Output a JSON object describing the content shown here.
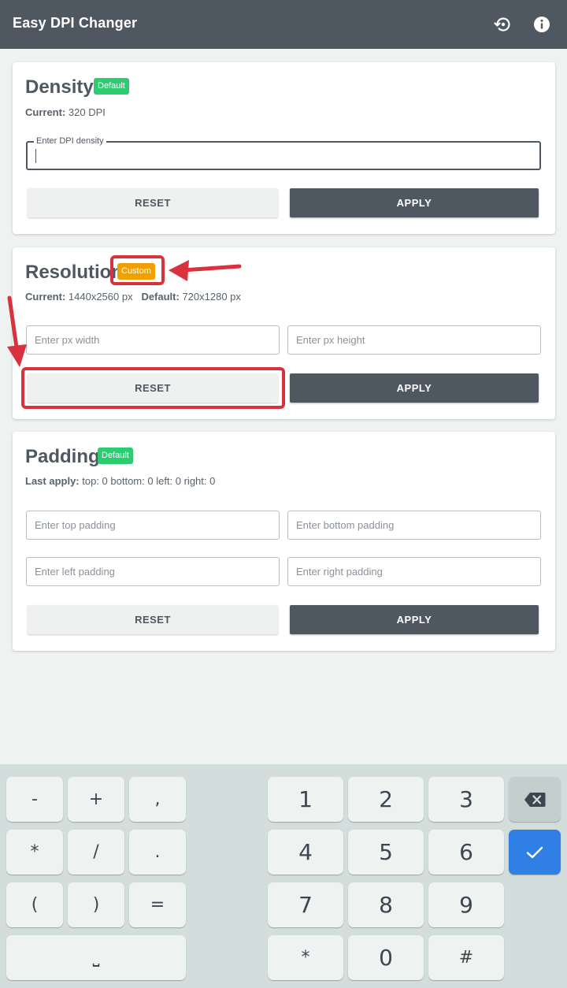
{
  "app": {
    "title": "Easy DPI Changer",
    "icons": [
      "restore-icon",
      "info-icon"
    ]
  },
  "density": {
    "title": "Density",
    "badge": "Default",
    "current_label": "Current:",
    "current_value": "320 DPI",
    "input_label": "Enter DPI density",
    "input_value": "",
    "reset_label": "RESET",
    "apply_label": "APPLY"
  },
  "resolution": {
    "title": "Resolution",
    "badge": "Custom",
    "current_label": "Current:",
    "current_value": "1440x2560 px",
    "default_label": "Default:",
    "default_value": "720x1280 px",
    "width_placeholder": "Enter px width",
    "height_placeholder": "Enter px height",
    "reset_label": "RESET",
    "apply_label": "APPLY"
  },
  "padding": {
    "title": "Padding",
    "badge": "Default",
    "last_label": "Last apply:",
    "last_value": "top: 0 bottom: 0 left: 0 right: 0",
    "top_placeholder": "Enter top padding",
    "bottom_placeholder": "Enter bottom padding",
    "left_placeholder": "Enter left padding",
    "right_placeholder": "Enter right padding",
    "reset_label": "RESET",
    "apply_label": "APPLY"
  },
  "keyboard": {
    "symbol_keys": [
      "-",
      "+",
      ",",
      "*",
      "/",
      ".",
      "(",
      ")",
      "=",
      "⎵"
    ],
    "number_keys": [
      "1",
      "2",
      "3",
      "4",
      "5",
      "6",
      "7",
      "8",
      "9",
      "*",
      "0",
      "#"
    ],
    "icons": [
      "backspace-icon",
      "checkmark-icon"
    ]
  },
  "colors": {
    "appbar": "#4f5761",
    "badge_default": "#2ecc71",
    "badge_custom": "#f0a000",
    "annotation": "#d9323f",
    "keyboard_done": "#2f7fe5"
  }
}
